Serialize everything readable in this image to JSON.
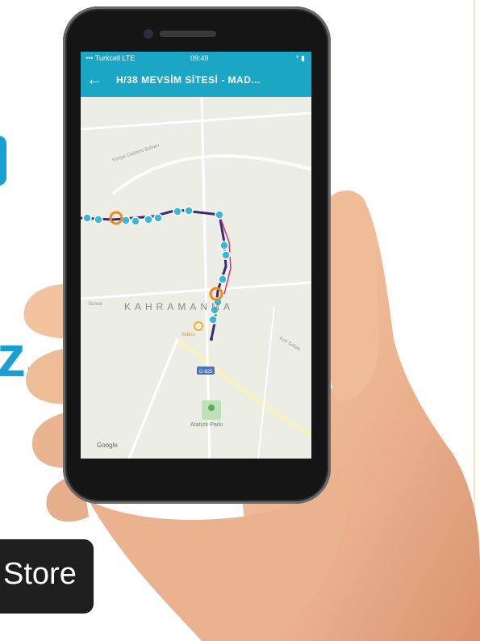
{
  "status_bar": {
    "carrier": "••• Turkcell LTE",
    "time": "09:49",
    "battery": "* ▮"
  },
  "header": {
    "title": "H/38 MEVSİM SİTESİ - MAD..."
  },
  "map": {
    "city_label": "KAHRAMANMA",
    "road_badge": "D-825",
    "park_label": "Atatürk Parkı",
    "street_label_1": "Kimya Caddesi Bulvarı",
    "street_label_2": "Bulvar",
    "street_label_3": "Kırk Sokak",
    "stop_label": "Kıbrıs",
    "attribution": "Google"
  },
  "ad": {
    "store_label": "Store",
    "z_glyph": "z."
  },
  "colors": {
    "app_bar": "#1aa6c4",
    "route_line": "#3a2a7a",
    "stop_marker": "#36b8d8",
    "active_marker": "#f08a1c"
  }
}
